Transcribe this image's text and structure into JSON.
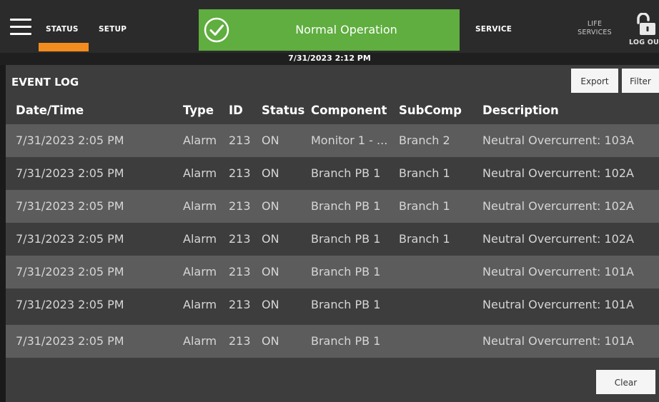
{
  "nav": {
    "status": "STATUS",
    "setup": "SETUP",
    "service": "SERVICE",
    "life_line1": "LIFE",
    "life_line2": "SERVICES",
    "logout": "LOG OU"
  },
  "banner": {
    "text": "Normal Operation",
    "color": "#5fae3f"
  },
  "accent_color": "#f28c1e",
  "datetime": "7/31/2023 2:12 PM",
  "event_log": {
    "title": "EVENT LOG",
    "export_label": "Export",
    "filter_label": "Filter",
    "clear_label": "Clear",
    "columns": [
      "Date/Time",
      "Type",
      "ID",
      "Status",
      "Component",
      "SubComp",
      "Description"
    ],
    "rows": [
      [
        "7/31/2023 2:05 PM",
        "Alarm",
        "213",
        "ON",
        "Monitor 1 - ...",
        "Branch 2",
        "Neutral Overcurrent: 103A"
      ],
      [
        "7/31/2023 2:05 PM",
        "Alarm",
        "213",
        "ON",
        "Branch PB 1",
        "Branch 1",
        "Neutral Overcurrent: 102A"
      ],
      [
        "7/31/2023 2:05 PM",
        "Alarm",
        "213",
        "ON",
        "Branch PB 1",
        "Branch 1",
        "Neutral Overcurrent: 102A"
      ],
      [
        "7/31/2023 2:05 PM",
        "Alarm",
        "213",
        "ON",
        "Branch PB 1",
        "Branch 1",
        "Neutral Overcurrent: 102A"
      ],
      [
        "7/31/2023 2:05 PM",
        "Alarm",
        "213",
        "ON",
        "Branch PB 1",
        "",
        "Neutral Overcurrent: 101A"
      ],
      [
        "7/31/2023 2:05 PM",
        "Alarm",
        "213",
        "ON",
        "Branch PB 1",
        "",
        "Neutral Overcurrent: 101A"
      ],
      [
        "7/31/2023 2:05 PM",
        "Alarm",
        "213",
        "ON",
        "Branch PB 1",
        "",
        "Neutral Overcurrent: 101A"
      ]
    ]
  },
  "icons": {
    "menu": "hamburger-menu-icon",
    "check": "check-circle-icon",
    "lock": "unlocked-padlock-icon"
  }
}
